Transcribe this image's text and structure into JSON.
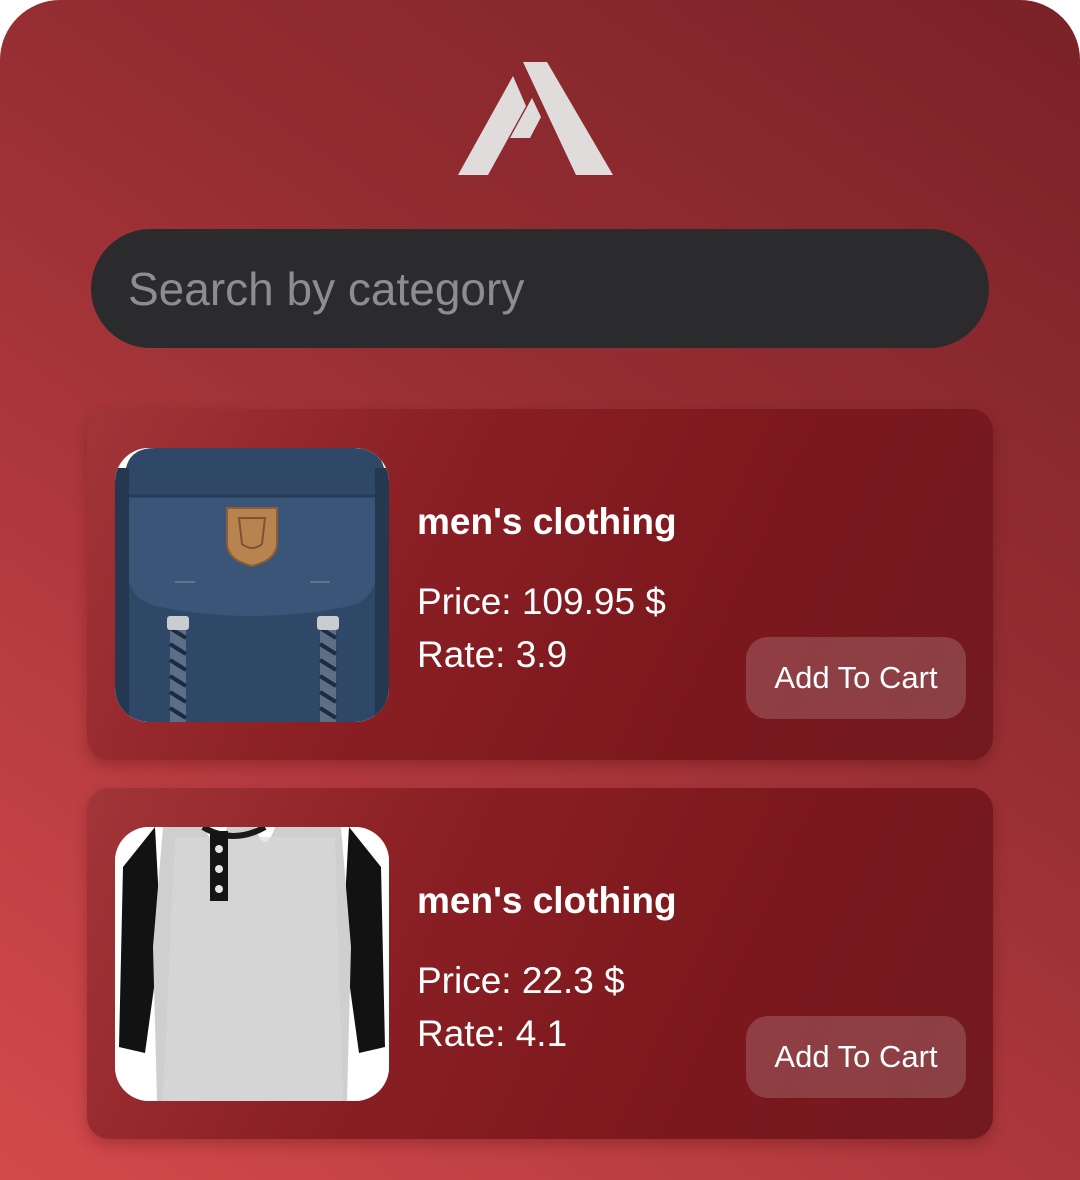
{
  "app": {
    "logo_icon": "triangle-a-logo-icon",
    "colors": {
      "background_light": "#d44a4c",
      "background_dark": "#7a2227",
      "card": "#7b181d",
      "search_bg": "#2b2b2d",
      "logo": "#e0dcdc"
    }
  },
  "search": {
    "placeholder": "Search by category",
    "value": ""
  },
  "products": [
    {
      "category": "men's clothing",
      "price": "Price: 109.95 $",
      "rate": "Rate: 3.9",
      "image_icon": "backpack-image",
      "cart_label": "Add To Cart"
    },
    {
      "category": "men's clothing",
      "price": "Price: 22.3 $",
      "rate": "Rate: 4.1",
      "image_icon": "henley-shirt-image",
      "cart_label": "Add To Cart"
    }
  ]
}
